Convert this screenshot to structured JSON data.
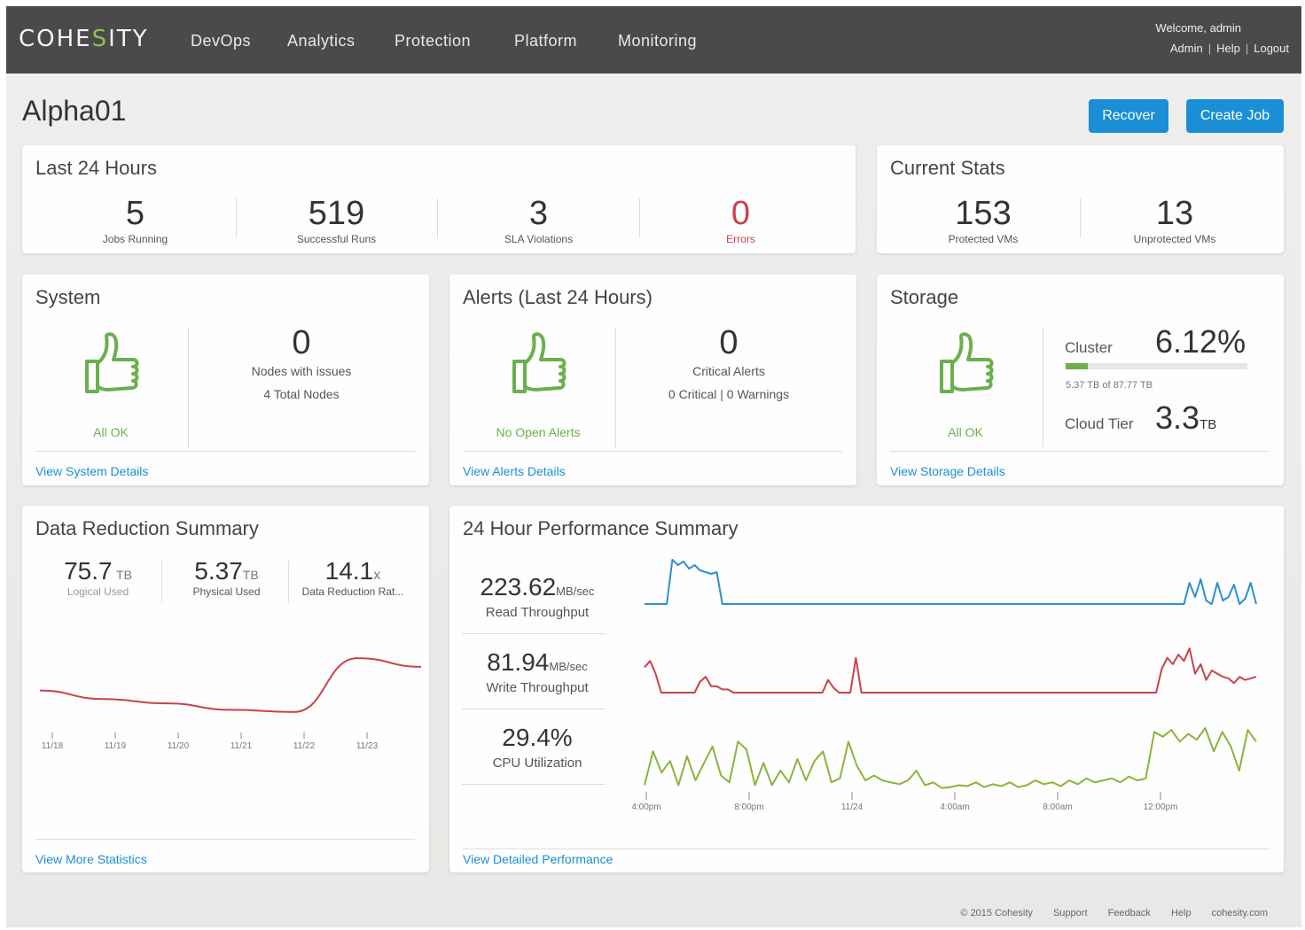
{
  "app": {
    "logo": "COHESITY",
    "nav": [
      "DevOps",
      "Analytics",
      "Protection",
      "Platform",
      "Monitoring"
    ],
    "welcome": "Welcome, admin",
    "user_links": [
      "Admin",
      "Help",
      "Logout"
    ]
  },
  "page": {
    "title": "Alpha01",
    "recover_label": "Recover",
    "create_job_label": "Create Job"
  },
  "last24": {
    "title": "Last 24 Hours",
    "stats": [
      {
        "value": "5",
        "label": "Jobs Running"
      },
      {
        "value": "519",
        "label": "Successful Runs"
      },
      {
        "value": "3",
        "label": "SLA Violations"
      },
      {
        "value": "0",
        "label": "Errors"
      }
    ]
  },
  "current_stats": {
    "title": "Current Stats",
    "stats": [
      {
        "value": "153",
        "label": "Protected VMs"
      },
      {
        "value": "13",
        "label": "Unprotected VMs"
      }
    ]
  },
  "system": {
    "title": "System",
    "status": "All OK",
    "count": "0",
    "line1": "Nodes with issues",
    "line2": "4 Total Nodes",
    "link": "View System Details"
  },
  "alerts": {
    "title": "Alerts (Last 24 Hours)",
    "status": "No Open Alerts",
    "count": "0",
    "line1": "Critical Alerts",
    "line2": "0 Critical | 0 Warnings",
    "link": "View Alerts Details"
  },
  "storage": {
    "title": "Storage",
    "status": "All OK",
    "cluster_label": "Cluster",
    "cluster_pct": "6.12%",
    "cluster_fill": 0.12,
    "cluster_detail": "5.37 TB of 87.77 TB",
    "cloud_label": "Cloud Tier",
    "cloud_value": "3.3",
    "cloud_unit": "TB",
    "link": "View Storage Details"
  },
  "data_reduction": {
    "title": "Data Reduction Summary",
    "metrics": [
      {
        "value": "75.7",
        "unit": "TB",
        "label": "Logical Used"
      },
      {
        "value": "5.37",
        "unit": "TB",
        "label": "Physical Used"
      },
      {
        "value": "14.1",
        "unit": "x",
        "label": "Data Reduction Rat..."
      }
    ],
    "link": "View More Statistics"
  },
  "performance": {
    "title": "24 Hour Performance Summary",
    "metrics": [
      {
        "value": "223.62",
        "unit": "MB/sec",
        "label": "Read Throughput"
      },
      {
        "value": "81.94",
        "unit": "MB/sec",
        "label": "Write Throughput"
      },
      {
        "value": "29.4%",
        "unit": "",
        "label": "CPU Utilization"
      }
    ],
    "link": "View Detailed Performance"
  },
  "chart_data": [
    {
      "type": "line",
      "title": "",
      "x": [
        "11/18",
        "11/19",
        "11/20",
        "11/21",
        "11/22",
        "11/23"
      ],
      "series": [
        {
          "values": [
            30,
            22,
            18,
            12,
            10,
            60,
            52
          ],
          "color": "#c9424a"
        }
      ],
      "ylim": [
        0,
        70
      ],
      "grid": false
    },
    {
      "type": "line",
      "title": "",
      "x": [
        "4:00pm",
        "8:00pm",
        "11/24",
        "4:00am",
        "8:00am",
        "12:00pm"
      ],
      "series": [
        {
          "name": "Read Throughput",
          "color": "#2f8fd0",
          "values": [
            0,
            0,
            0,
            0,
            0,
            25,
            22,
            24,
            20,
            22,
            19,
            18,
            17,
            18,
            0,
            0,
            0,
            0,
            0,
            0,
            0,
            0,
            0,
            0,
            0,
            0,
            0,
            0,
            0,
            0,
            0,
            0,
            0,
            0,
            0,
            0,
            0,
            0,
            0,
            0,
            0,
            0,
            0,
            0,
            0,
            0,
            0,
            0,
            0,
            0,
            0,
            0,
            0,
            0,
            0,
            0,
            0,
            0,
            0,
            0,
            0,
            0,
            0,
            0,
            0,
            0,
            0,
            0,
            0,
            0,
            0,
            0,
            0,
            0,
            0,
            0,
            0,
            0,
            0,
            0,
            0,
            0,
            0,
            0,
            0,
            0,
            0,
            0,
            0,
            0,
            0,
            0,
            0,
            0,
            0,
            0,
            0,
            0,
            12,
            4,
            14,
            2,
            0,
            12,
            2,
            4,
            11,
            0,
            3,
            12,
            0
          ]
        },
        {
          "name": "Write Throughput",
          "color": "#c9424a",
          "values": [
            16,
            20,
            12,
            0,
            0,
            0,
            0,
            0,
            0,
            0,
            7,
            10,
            4,
            4,
            2,
            2,
            0,
            0,
            0,
            0,
            0,
            0,
            0,
            0,
            0,
            0,
            0,
            0,
            0,
            0,
            0,
            0,
            0,
            8,
            3,
            0,
            0,
            0,
            22,
            0,
            0,
            0,
            0,
            0,
            0,
            0,
            0,
            0,
            0,
            0,
            0,
            0,
            0,
            0,
            0,
            0,
            0,
            0,
            0,
            0,
            0,
            0,
            0,
            0,
            0,
            0,
            0,
            0,
            0,
            0,
            0,
            0,
            0,
            0,
            0,
            0,
            0,
            0,
            0,
            0,
            0,
            0,
            0,
            0,
            0,
            0,
            0,
            0,
            0,
            0,
            0,
            0,
            0,
            15,
            22,
            18,
            24,
            20,
            28,
            12,
            18,
            8,
            14,
            12,
            10,
            9,
            6,
            10,
            8,
            9,
            10
          ]
        },
        {
          "name": "CPU Utilization",
          "color": "#8ab43a",
          "values": [
            5,
            40,
            18,
            30,
            5,
            35,
            10,
            28,
            45,
            15,
            8,
            50,
            42,
            5,
            28,
            5,
            20,
            8,
            32,
            10,
            30,
            40,
            8,
            12,
            50,
            25,
            10,
            15,
            10,
            8,
            6,
            10,
            20,
            5,
            8,
            2,
            3,
            5,
            4,
            8,
            3,
            6,
            4,
            8,
            3,
            5,
            10,
            6,
            8,
            4,
            10,
            6,
            12,
            8,
            10,
            12,
            8,
            14,
            10,
            12,
            60,
            55,
            62,
            50,
            58,
            52,
            64,
            40,
            60,
            45,
            20,
            62,
            50
          ]
        }
      ]
    }
  ],
  "footer": [
    "© 2015 Cohesity",
    "Support",
    "Feedback",
    "Help",
    "cohesity.com"
  ]
}
